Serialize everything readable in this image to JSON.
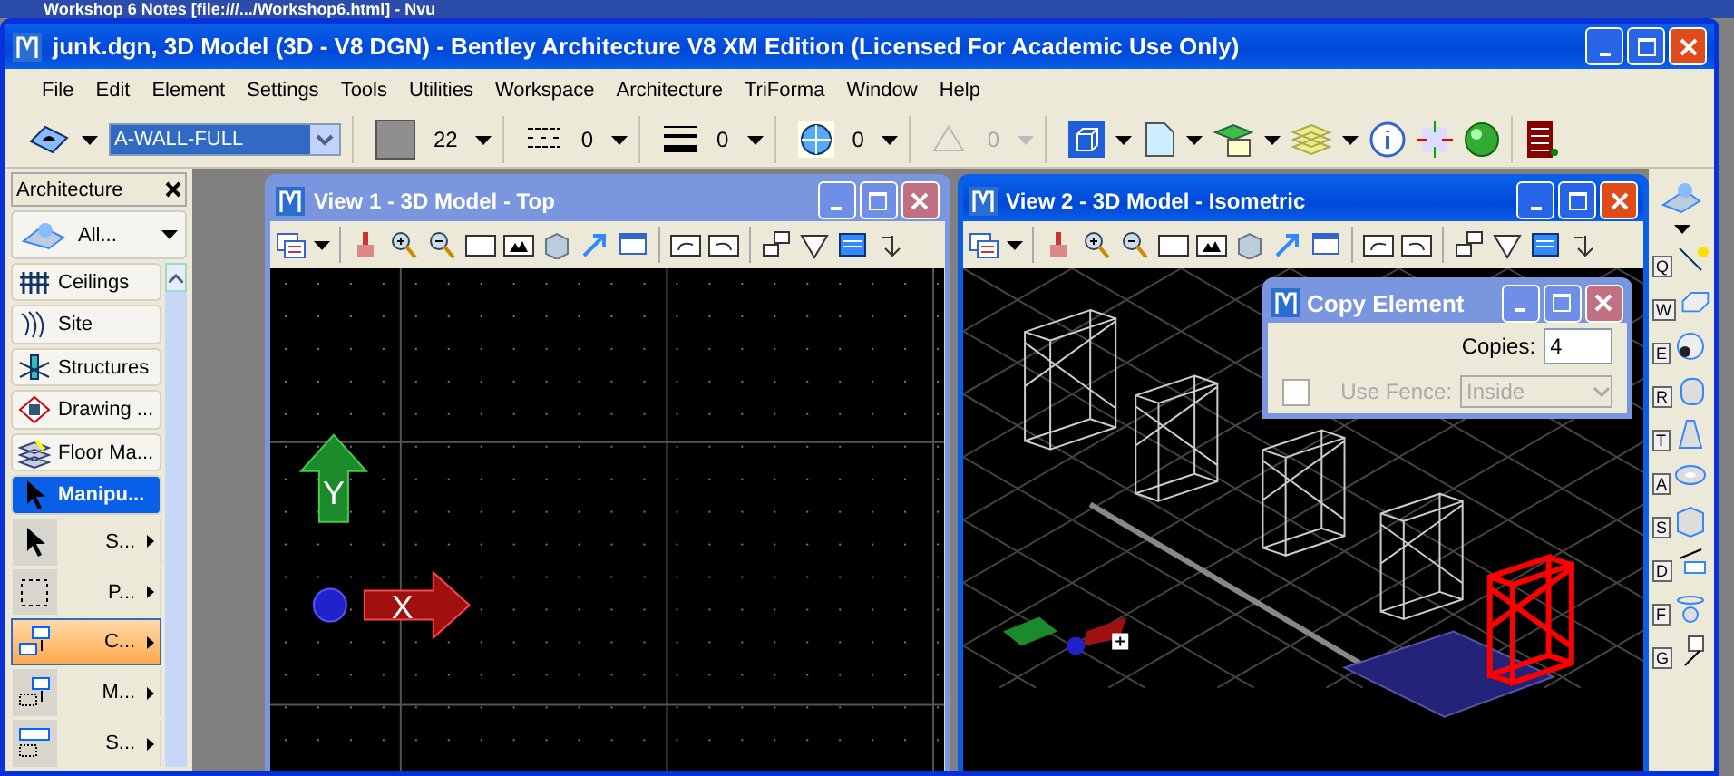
{
  "background_window": {
    "title": "Workshop 6 Notes [file:///.../Workshop6.html] - Nvu"
  },
  "window": {
    "title": "junk.dgn, 3D Model (3D - V8 DGN) - Bentley Architecture V8 XM Edition (Licensed For Academic Use Only)"
  },
  "menu": [
    "File",
    "Edit",
    "Element",
    "Settings",
    "Tools",
    "Utilities",
    "Workspace",
    "Architecture",
    "TriForma",
    "Window",
    "Help"
  ],
  "toolbar": {
    "level": "A-WALL-FULL",
    "color_value": "22",
    "line_style_value": "0",
    "line_weight_value": "0",
    "display_value": "0",
    "disabled_value": "0"
  },
  "task_panel": {
    "title": "Architecture",
    "category": "All...",
    "tasks": [
      {
        "label": "Ceilings",
        "kind": "ceiling",
        "selected": false
      },
      {
        "label": "Site",
        "kind": "site",
        "selected": false
      },
      {
        "label": "Structures",
        "kind": "structure",
        "selected": false
      },
      {
        "label": "Drawing ...",
        "kind": "drawing",
        "selected": false
      },
      {
        "label": "Floor Ma...",
        "kind": "floor",
        "selected": false
      },
      {
        "label": "Manipu...",
        "kind": "pointer",
        "selected": true
      }
    ],
    "tools": [
      {
        "label": "S...",
        "kind": "pointer",
        "selected": false
      },
      {
        "label": "P...",
        "kind": "dashed",
        "selected": false
      },
      {
        "label": "C...",
        "kind": "copy",
        "selected": true
      },
      {
        "label": "M...",
        "kind": "move",
        "selected": false
      },
      {
        "label": "S...",
        "kind": "scale",
        "selected": false
      }
    ]
  },
  "views": [
    {
      "title": "View 1 - 3D Model - Top",
      "kind": "top",
      "active": false,
      "axis_labels": [
        "Y",
        "X"
      ]
    },
    {
      "title": "View 2 - 3D Model - Isometric",
      "kind": "iso",
      "active": true
    }
  ],
  "dialog": {
    "title": "Copy Element",
    "copies_label": "Copies:",
    "copies": "4",
    "use_fence_label": "Use Fence:",
    "use_fence_checked": false,
    "fence_disabled": true,
    "fence_mode": "Inside"
  },
  "side_tools": {
    "keys": [
      "Q",
      "W",
      "E",
      "R",
      "T",
      "A",
      "S",
      "D",
      "F",
      "G"
    ]
  }
}
